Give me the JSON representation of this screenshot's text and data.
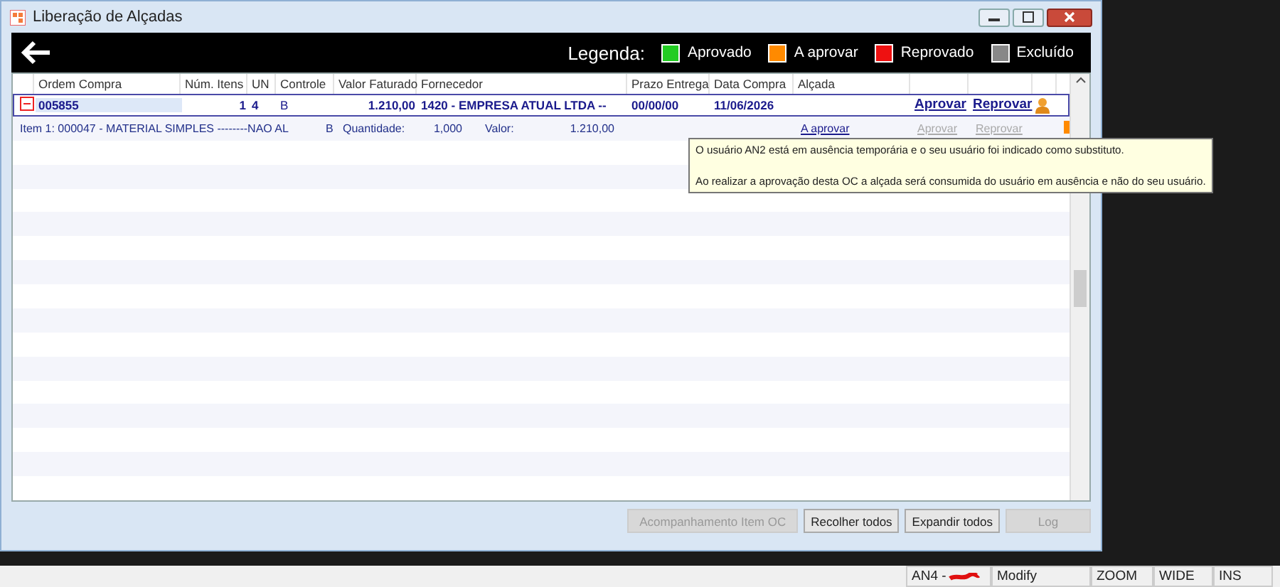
{
  "window": {
    "title": "Liberação de Alçadas"
  },
  "legend": {
    "label": "Legenda:",
    "items": [
      {
        "label": "Aprovado",
        "color": "#22cc22"
      },
      {
        "label": "A aprovar",
        "color": "#ff8a00"
      },
      {
        "label": "Reprovado",
        "color": "#ee1111"
      },
      {
        "label": "Excluído",
        "color": "#888888"
      }
    ]
  },
  "table": {
    "columns": [
      "Ordem Compra",
      "Núm. Itens",
      "UN",
      "Controle",
      "Valor Faturado",
      "Fornecedor",
      "Prazo Entrega",
      "Data Compra",
      "Alçada"
    ],
    "rows": [
      {
        "expanded": true,
        "order": "005855",
        "items": "1",
        "un": "4",
        "control": "B",
        "value": "1.210,00",
        "supplier": "1420 - EMPRESA ATUAL LTDA  --",
        "deadline": "00/00/00",
        "date": "11/06/2026",
        "approve": "Aprovar",
        "reject": "Reprovar",
        "details": [
          {
            "item": "Item 1: 000047 - MATERIAL SIMPLES --------NAO AL",
            "control": "B",
            "qty_label": "Quantidade:",
            "qty": "1,000",
            "value_label": "Valor:",
            "value": "1.210,00",
            "status": "A aprovar",
            "approve": "Aprovar",
            "reject": "Reprovar",
            "disabled": true,
            "color": "#ff8a00"
          }
        ]
      }
    ]
  },
  "tooltip": {
    "lines": [
      "O usuário AN2 está em ausência temporária e o seu usuário foi indicado como substituto.",
      "Ao realizar a aprovação desta OC a alçada será consumida do usuário em ausência e não do seu usuário."
    ]
  },
  "buttons": [
    {
      "label": "Acompanhamento Item OC",
      "disabled": true
    },
    {
      "label": "Recolher todos",
      "disabled": false
    },
    {
      "label": "Expandir todos",
      "disabled": false
    },
    {
      "label": "Log",
      "disabled": true
    }
  ],
  "status_bar": [
    {
      "text": "AN4 -",
      "redacted": true
    },
    {
      "text": "Modify",
      "redacted": false
    },
    {
      "text": "ZOOM",
      "redacted": false
    },
    {
      "text": "WIDE",
      "redacted": false
    },
    {
      "text": "INS",
      "redacted": false
    }
  ]
}
